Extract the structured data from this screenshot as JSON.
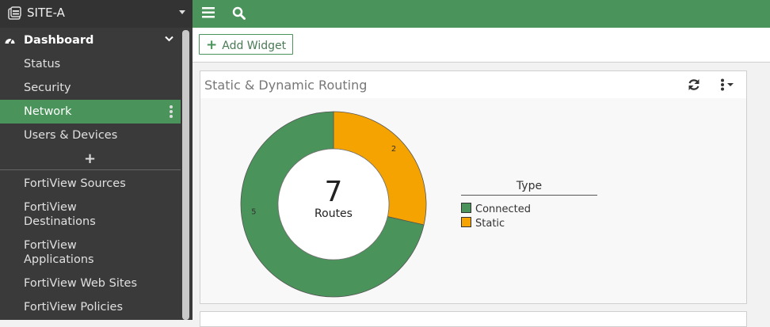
{
  "sidebar": {
    "site_name": "SITE-A",
    "dashboard_label": "Dashboard",
    "items": [
      {
        "label": "Status"
      },
      {
        "label": "Security"
      },
      {
        "label": "Network"
      },
      {
        "label": "Users & Devices"
      }
    ],
    "add_label": "+",
    "fortiview": [
      {
        "label": "FortiView Sources"
      },
      {
        "label": "FortiView\nDestinations"
      },
      {
        "label": "FortiView\nApplications"
      },
      {
        "label": "FortiView Web Sites"
      },
      {
        "label": "FortiView Policies"
      }
    ]
  },
  "topbar": {
    "icons": [
      "menu-icon",
      "search-icon"
    ]
  },
  "toolbar": {
    "add_widget_label": "Add Widget"
  },
  "widget": {
    "title": "Static & Dynamic Routing",
    "center_value": "7",
    "center_label": "Routes",
    "legend_title": "Type",
    "legend": [
      {
        "label": "Connected",
        "color": "#4a935a"
      },
      {
        "label": "Static",
        "color": "#f5a300"
      }
    ]
  },
  "chart_data": {
    "type": "pie",
    "categories": [
      "Connected",
      "Static"
    ],
    "values": [
      5,
      2
    ],
    "title": "Static & Dynamic Routing",
    "total": 7,
    "total_label": "Routes",
    "legend_title": "Type",
    "colors": [
      "#4a935a",
      "#f5a300"
    ]
  },
  "colors": {
    "accent": "#4a935a",
    "sidebar": "#3a3a3a",
    "static": "#f5a300"
  }
}
